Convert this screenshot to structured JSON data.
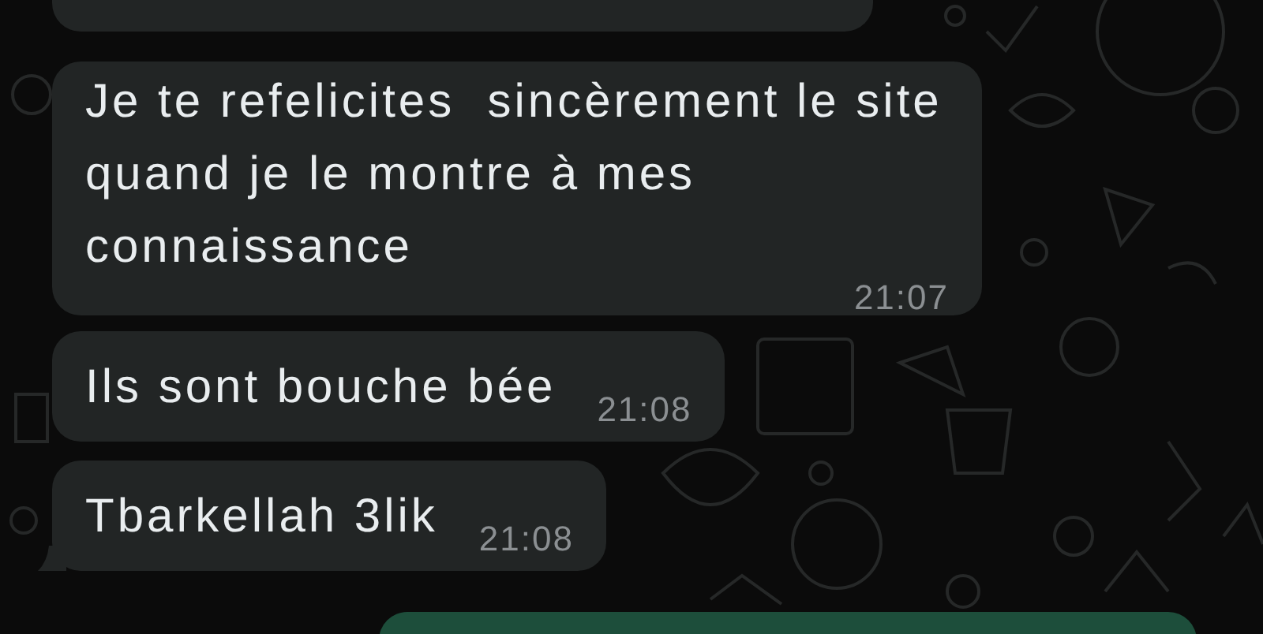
{
  "messages": [
    {
      "kind": "wrapped",
      "text": "Je te refelicites  sincèrement le site quand je le montre à mes connaissance",
      "time": "21:07",
      "tail": false
    },
    {
      "kind": "inline",
      "text": "Ils sont bouche bée",
      "time": "21:08",
      "tail": false
    },
    {
      "kind": "inline",
      "text": "Tbarkellah 3lik",
      "time": "21:08",
      "tail": true
    }
  ]
}
